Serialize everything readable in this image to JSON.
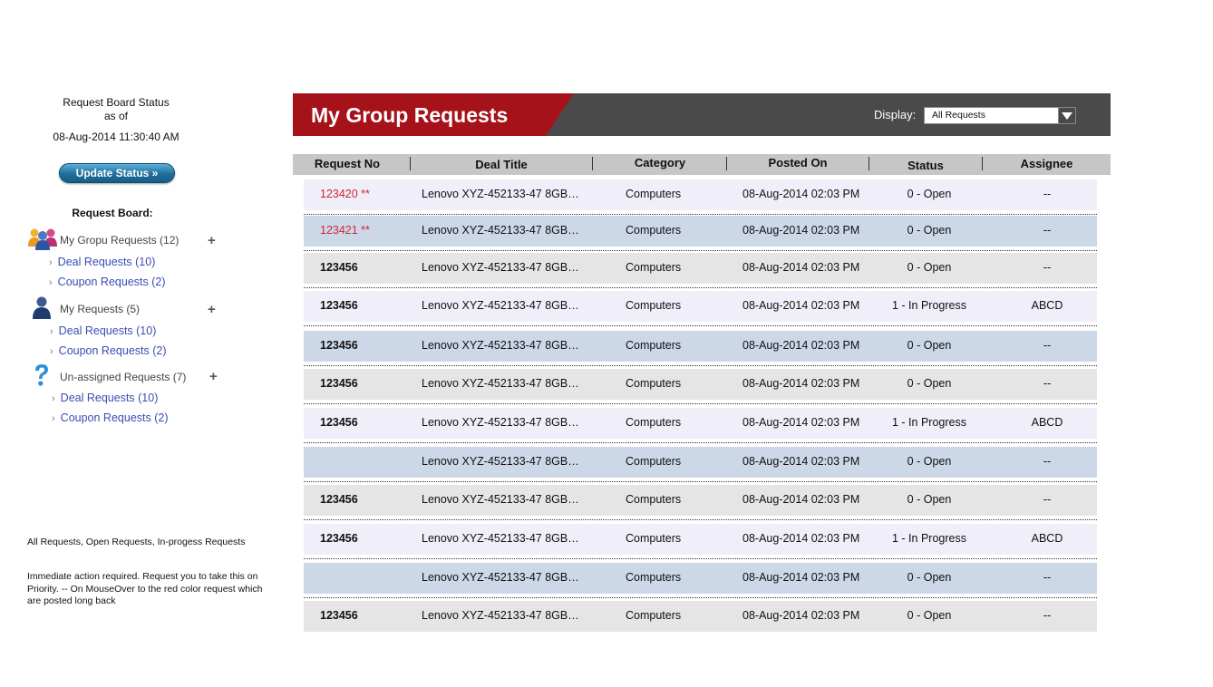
{
  "sidebar": {
    "status_line1": "Request Board Status",
    "status_line2": "as of",
    "status_time": "08-Aug-2014 11:30:40 AM",
    "update_button": "Update Status »",
    "board_heading": "Request Board:",
    "groups": [
      {
        "label": "My Gropu Requests (12)",
        "icon": "group-users-icon",
        "items": [
          {
            "label": "Deal Requests (10)"
          },
          {
            "label": "Coupon Requests (2)"
          }
        ]
      },
      {
        "label": "My Requests (5)",
        "icon": "user-icon",
        "items": [
          {
            "label": "Deal Requests (10)"
          },
          {
            "label": "Coupon Requests (2)"
          }
        ]
      },
      {
        "label": "Un-assigned Requests (7)",
        "icon": "question-icon",
        "items": [
          {
            "label": "Deal Requests (10)"
          },
          {
            "label": "Coupon Requests (2)"
          }
        ]
      }
    ],
    "plus": "+",
    "chevron": "›",
    "note1": "All Requests, Open Requests, In-progess Requests",
    "note2": "Immediate action required. Request you to take this on Priority. -- On MouseOver to the red color request which are posted long back"
  },
  "header": {
    "title": "My Group Requests",
    "display_label": "Display:",
    "display_value": "All Requests"
  },
  "table": {
    "columns": [
      "Request No",
      "Deal Title",
      "Category",
      "Posted On",
      "Status",
      "Assignee"
    ],
    "rows": [
      {
        "no": "123420 **",
        "urgent": true,
        "title": "Lenovo XYZ-452133-47 8GB…",
        "category": "Computers",
        "posted": "08-Aug-2014 02:03 PM",
        "status": "0 - Open",
        "assignee": "--"
      },
      {
        "no": "123421 **",
        "urgent": true,
        "title": "Lenovo XYZ-452133-47 8GB…",
        "category": "Computers",
        "posted": "08-Aug-2014 02:03 PM",
        "status": "0 - Open",
        "assignee": "--"
      },
      {
        "no": "123456",
        "urgent": false,
        "title": "Lenovo XYZ-452133-47 8GB…",
        "category": "Computers",
        "posted": "08-Aug-2014 02:03 PM",
        "status": "0 - Open",
        "assignee": "--"
      },
      {
        "no": "123456",
        "urgent": false,
        "title": "Lenovo XYZ-452133-47 8GB…",
        "category": "Computers",
        "posted": "08-Aug-2014 02:03 PM",
        "status": "1 - In Progress",
        "assignee": "ABCD"
      },
      {
        "no": "123456",
        "urgent": false,
        "title": "Lenovo XYZ-452133-47 8GB…",
        "category": "Computers",
        "posted": "08-Aug-2014 02:03 PM",
        "status": "0 - Open",
        "assignee": "--"
      },
      {
        "no": "123456",
        "urgent": false,
        "title": "Lenovo XYZ-452133-47 8GB…",
        "category": "Computers",
        "posted": "08-Aug-2014 02:03 PM",
        "status": "0 - Open",
        "assignee": "--"
      },
      {
        "no": "123456",
        "urgent": false,
        "title": "Lenovo XYZ-452133-47 8GB…",
        "category": "Computers",
        "posted": "08-Aug-2014 02:03 PM",
        "status": "1 - In Progress",
        "assignee": "ABCD"
      },
      {
        "no": "",
        "urgent": false,
        "title": "Lenovo XYZ-452133-47 8GB…",
        "category": "Computers",
        "posted": "08-Aug-2014 02:03 PM",
        "status": "0 - Open",
        "assignee": "--"
      },
      {
        "no": "123456",
        "urgent": false,
        "title": "Lenovo XYZ-452133-47 8GB…",
        "category": "Computers",
        "posted": "08-Aug-2014 02:03 PM",
        "status": "0 - Open",
        "assignee": "--"
      },
      {
        "no": "123456",
        "urgent": false,
        "title": "Lenovo XYZ-452133-47 8GB…",
        "category": "Computers",
        "posted": "08-Aug-2014 02:03 PM",
        "status": "1 - In Progress",
        "assignee": "ABCD"
      },
      {
        "no": "",
        "urgent": false,
        "title": "Lenovo XYZ-452133-47 8GB…",
        "category": "Computers",
        "posted": "08-Aug-2014 02:03 PM",
        "status": "0 - Open",
        "assignee": "--"
      },
      {
        "no": "123456",
        "urgent": false,
        "title": "Lenovo XYZ-452133-47 8GB…",
        "category": "Computers",
        "posted": "08-Aug-2014 02:03 PM",
        "status": "0 - Open",
        "assignee": "--"
      }
    ]
  },
  "colors": {
    "header_red": "#a5121a",
    "header_dark": "#4a4a4a",
    "urgent_text": "#d22630",
    "link_blue": "#3a4db3",
    "row_colors": [
      "#efeef9",
      "#ccd8e8",
      "#e5e5e5"
    ]
  }
}
